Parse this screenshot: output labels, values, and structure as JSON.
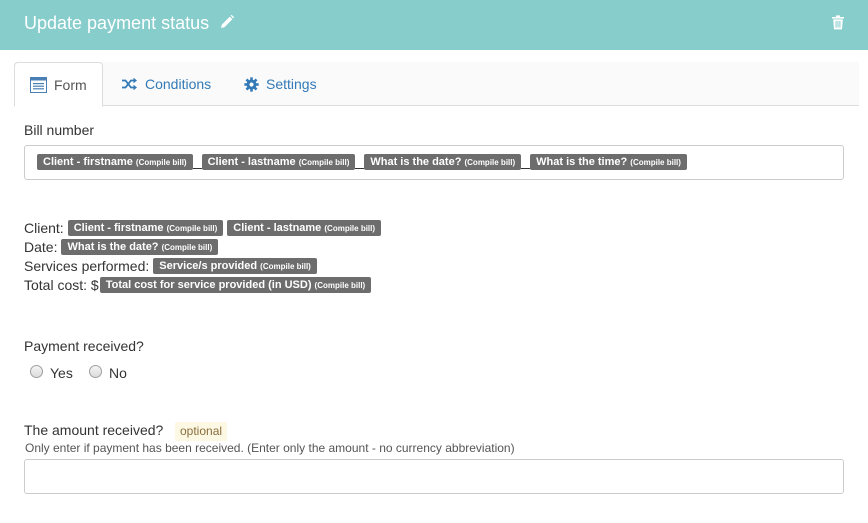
{
  "header": {
    "title": "Update payment status",
    "edit_icon": "pencil-icon",
    "delete_icon": "trash-icon",
    "background_color": "#86cdcc"
  },
  "tabs": [
    {
      "label": "Form",
      "icon": "form-icon",
      "active": true
    },
    {
      "label": "Conditions",
      "icon": "shuffle-icon",
      "active": false
    },
    {
      "label": "Settings",
      "icon": "gear-icon",
      "active": false
    }
  ],
  "bill_number": {
    "label": "Bill number",
    "tags": [
      {
        "text": "Client - firstname",
        "source": "(Compile bill)"
      },
      {
        "text": "Client - lastname",
        "source": "(Compile bill)"
      },
      {
        "text": "What is the date?",
        "source": "(Compile bill)"
      },
      {
        "text": "What is the time?",
        "source": "(Compile bill)"
      }
    ]
  },
  "summary": {
    "client": {
      "label": "Client:",
      "tags": [
        {
          "text": "Client - firstname",
          "source": "(Compile bill)"
        },
        {
          "text": "Client - lastname",
          "source": "(Compile bill)"
        }
      ]
    },
    "date": {
      "label": "Date:",
      "tags": [
        {
          "text": "What is the date?",
          "source": "(Compile bill)"
        }
      ]
    },
    "services": {
      "label": "Services performed:",
      "tags": [
        {
          "text": "Service/s provided",
          "source": "(Compile bill)"
        }
      ]
    },
    "total": {
      "label": "Total cost: $",
      "tags": [
        {
          "text": "Total cost for service provided (in USD)",
          "source": "(Compile bill)"
        }
      ]
    }
  },
  "payment_received": {
    "label": "Payment received?",
    "options": [
      "Yes",
      "No"
    ]
  },
  "amount_received": {
    "label": "The amount received?",
    "badge": "optional",
    "help": "Only enter if payment has been received. (Enter only the amount - no currency abbreviation)",
    "value": ""
  }
}
